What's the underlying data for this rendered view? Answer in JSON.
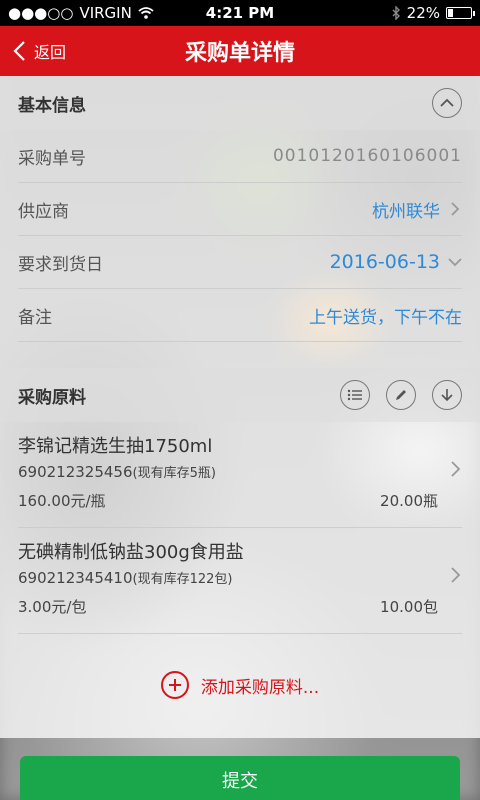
{
  "status_bar": {
    "carrier": "VIRGIN",
    "time": "4:21 PM",
    "battery": "22%",
    "battery_level": 0.22
  },
  "nav": {
    "back_label": "返回",
    "title": "采购单详情"
  },
  "basic_info": {
    "header": "基本信息",
    "rows": [
      {
        "label": "采购单号",
        "value": "0010120160106001"
      },
      {
        "label": "供应商",
        "value": "杭州联华"
      },
      {
        "label": "要求到货日",
        "value": "2016-06-13"
      },
      {
        "label": "备注",
        "value": "上午送货，下午不在"
      }
    ]
  },
  "materials": {
    "header": "采购原料",
    "items": [
      {
        "name": "李锦记精选生抽1750ml",
        "barcode": "690212325456",
        "stock": "(现有库存5瓶)",
        "price": "160.00元/瓶",
        "quantity": "20.00瓶"
      },
      {
        "name": "无碘精制低钠盐300g食用盐",
        "barcode": "690212345410",
        "stock": "(现有库存122包)",
        "price": "3.00元/包",
        "quantity": "10.00包"
      }
    ],
    "add_label": "添加采购原料..."
  },
  "submit_label": "提交",
  "colors": {
    "brand_red": "#d6141a",
    "link_blue": "#2e8ad8",
    "submit_green": "#1aa64a"
  }
}
